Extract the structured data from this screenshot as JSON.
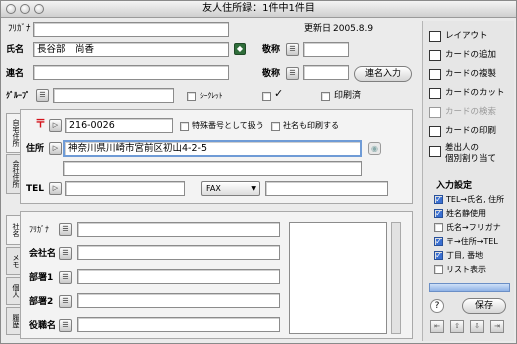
{
  "window": {
    "title": "友人住所録：1件中1件目"
  },
  "header": {
    "updated_label": "更新日",
    "updated_date": "2005.8.9"
  },
  "person": {
    "furigana_label": "ﾌﾘｶﾞﾅ",
    "furigana_value": "",
    "name_label": "氏名",
    "name_value": "長谷部　尚香",
    "honorific_label": "敬称",
    "honorific_value": "",
    "joint_name_label": "連名",
    "joint_name_value": "",
    "joint_honorific_label": "敬称",
    "joint_honorific_value": "",
    "joint_input_button": "連名入力",
    "group_label": "ｸﾞﾙｰﾌﾟ",
    "group_value": "",
    "secret_label": "ｼｰｸﾚｯﾄ",
    "printed_label": "印刷済",
    "check_mark": "✓"
  },
  "home_tab": {
    "tab_label": "自宅住所",
    "postal_mark": "〒",
    "postal_code": "216-0026",
    "special_number_label": "特殊番号として扱う",
    "print_company_label": "社名も印刷する",
    "address_label": "住所",
    "address_line1": "神奈川県川崎市宮前区初山4-2-5",
    "address_line2": "",
    "tel_label": "TEL",
    "tel_value": "",
    "fax_select": "FAX",
    "fax_value": ""
  },
  "company_tab": {
    "tab_label": "会社住所"
  },
  "company": {
    "tabs": [
      "社名",
      "メモ",
      "個人",
      "履歴"
    ],
    "furigana_label": "ﾌﾘｶﾞﾅ",
    "company_label": "会社名",
    "dept1_label": "部署1",
    "dept2_label": "部署2",
    "title_label": "役職名"
  },
  "sidebar": {
    "items": [
      {
        "label": "レイアウト",
        "icon": "layout-icon"
      },
      {
        "label": "カードの追加",
        "icon": "card-add-icon"
      },
      {
        "label": "カードの複製",
        "icon": "card-copy-icon"
      },
      {
        "label": "カードのカット",
        "icon": "card-cut-icon"
      },
      {
        "label": "カードの検索",
        "icon": "card-search-icon"
      },
      {
        "label": "カードの印刷",
        "icon": "card-print-icon"
      },
      {
        "label": "差出人の",
        "label2": "個別割り当て",
        "icon": "sender-icon"
      }
    ],
    "input_settings_title": "入力設定",
    "settings": [
      {
        "label": "TEL→氏名, 住所",
        "checked": true
      },
      {
        "label": "姓名静使用",
        "checked": true
      },
      {
        "label": "氏名→フリガナ",
        "checked": false
      },
      {
        "label": "〒→住所→TEL",
        "checked": true
      },
      {
        "label": "丁目, 番地",
        "checked": true
      },
      {
        "label": "リスト表示",
        "checked": false
      }
    ],
    "help_symbol": "?",
    "save_button": "保存"
  }
}
